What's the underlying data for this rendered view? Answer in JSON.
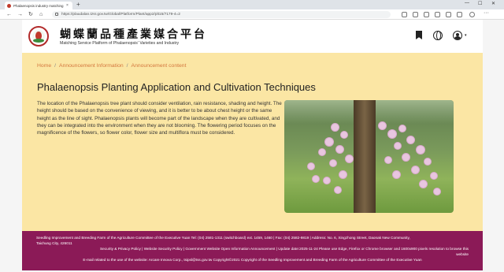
{
  "browser": {
    "tab_title": "Phalaenopsis industry matching",
    "tab_close": "×",
    "new_tab": "+",
    "url": "https://plaudalan.tzsr.gov.tw/Global/Platform/Plant/app2/plt15/7179-4=2",
    "win_min": "—",
    "win_max": "☐",
    "win_close": "✕",
    "nav_back": "←",
    "nav_forward": "→",
    "nav_reload": "↻",
    "nav_home": "⌂"
  },
  "header": {
    "title_zh": "蝴蝶蘭品種產業媒合平台",
    "title_en": "Matching Service Platform of Phalaenopsis' Varieties and Industry",
    "caret": "▾"
  },
  "breadcrumb": {
    "home": "Home",
    "sep": "/",
    "section": "Announcement Information",
    "current": "Announcement content"
  },
  "article": {
    "title": "Phalaenopsis Planting Application and Cultivation Techniques",
    "body": "The location of the Phalaenopsis tree plant should consider ventilation, rain resistance, shading and height. The height should be based on the convenience of viewing, and it is better to be about chest height or the same height as the line of sight. Phalaenopsis plants will become part of the landscape when they are cultivated, and they can be integrated into the environment when they are not blooming. The flowering period focuses on the magnificence of the flowers, so flower color, flower size and multiflora must be considered."
  },
  "footer": {
    "line1": "Seedling Improvement and Breeding Farm of the Agriculture Committee of the Executive Yuan Tel: (04) 2581-1311 (switchboard) ext. 1459, 1460  |  Fax: (04) 2582-9819  |  Address: No. 6, Xingzhong Street, Daonak New Community,",
    "line2": "Taichung City, 426011",
    "line3": "Security & Privacy Policy  |  Website Security Policy  |  Government Website Open Information Announcement  |  Update date:2025-11-24 Please use Edge, Firefox or Chrome browser and 1600x900 pixels resolution to browse this",
    "line4": "website",
    "line5": "E-mail related to the use of the website: Arcare Innova Corp., tsipsl@tss.gov.tw Copyright©2021 Copyright of the Seedling Improvement and Breeding Farm of the Agriculture Committee of the Executive Yuan"
  }
}
